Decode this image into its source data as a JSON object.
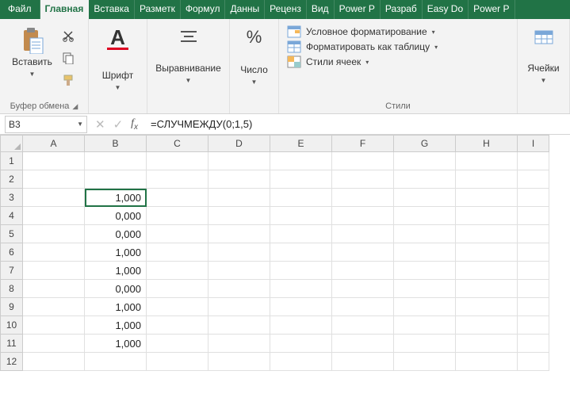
{
  "tabs": {
    "file": "Файл",
    "home": "Главная",
    "insert": "Вставка",
    "layout": "Разметк",
    "formulas": "Формул",
    "data": "Данны",
    "review": "Реценз",
    "view": "Вид",
    "powerp": "Power P",
    "dev": "Разраб",
    "easydo": "Easy Do",
    "powerp2": "Power P"
  },
  "ribbon": {
    "clipboard": {
      "group": "Буфер обмена",
      "paste": "Вставить"
    },
    "font": {
      "group": "Шрифт",
      "char": "А"
    },
    "alignment": {
      "group": "Выравнивание"
    },
    "number": {
      "group": "Число",
      "pct": "%"
    },
    "styles": {
      "group": "Стили",
      "cond": "Условное форматирование",
      "table": "Форматировать как таблицу",
      "cellstyles": "Стили ячеек"
    },
    "cells": {
      "group": "Ячейки"
    }
  },
  "fx": {
    "namebox": "B3",
    "formula": "=СЛУЧМЕЖДУ(0;1,5)"
  },
  "grid": {
    "cols": [
      "A",
      "B",
      "C",
      "D",
      "E",
      "F",
      "G",
      "H",
      "I"
    ],
    "rows": [
      1,
      2,
      3,
      4,
      5,
      6,
      7,
      8,
      9,
      10,
      11,
      12
    ],
    "selected": {
      "row": 3,
      "col": "B"
    },
    "data": {
      "B3": "1,000",
      "B4": "0,000",
      "B5": "0,000",
      "B6": "1,000",
      "B7": "1,000",
      "B8": "0,000",
      "B9": "1,000",
      "B10": "1,000",
      "B11": "1,000"
    }
  }
}
